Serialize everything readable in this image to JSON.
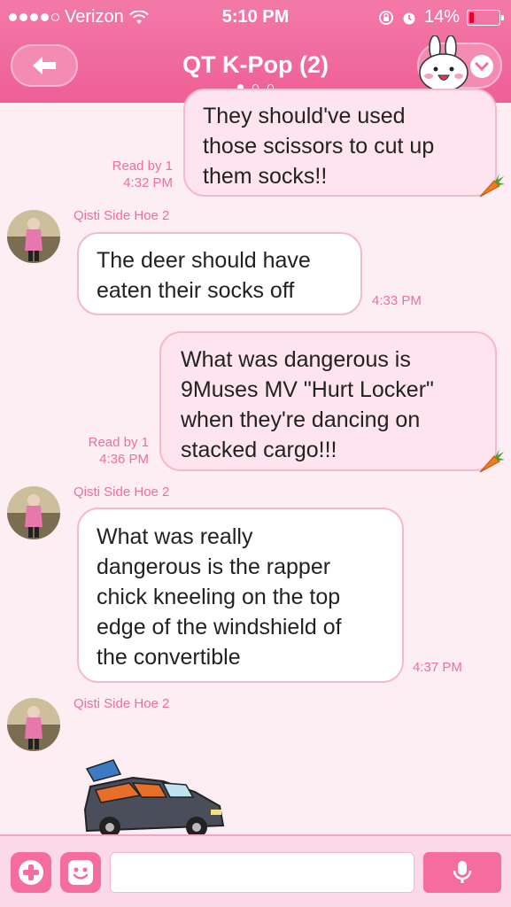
{
  "status_bar": {
    "carrier": "Verizon",
    "time": "5:10 PM",
    "battery": "14%",
    "signal_bars_filled": 4,
    "signal_bars_total": 5
  },
  "header": {
    "title": "QT K-Pop (2)",
    "page_count": 3,
    "active_page": 0
  },
  "messages": [
    {
      "type": "sent",
      "text": "They should've used\nthose scissors to cut up\nthem socks!!",
      "read": "Read by 1",
      "time": "4:32 PM"
    },
    {
      "type": "received",
      "sender": "Qisti Side Hoe 2",
      "text": "The deer should have\neaten their socks off",
      "time": "4:33 PM"
    },
    {
      "type": "sent",
      "text": "What was dangerous is\n9Muses MV \"Hurt Locker\"\nwhen they're dancing on\nstacked cargo!!!",
      "read": "Read by 1",
      "time": "4:36 PM"
    },
    {
      "type": "received",
      "sender": "Qisti Side Hoe 2",
      "text": "What was really\ndangerous is the rapper\nchick kneeling on the top\nedge of the windshield of\nthe convertible",
      "time": "4:37 PM"
    },
    {
      "type": "received-sticker",
      "sender": "Qisti Side Hoe 2",
      "sticker": "convertible-car-sticker"
    }
  ],
  "input": {
    "placeholder": "",
    "value": ""
  },
  "icons": {
    "back": "back-arrow-icon",
    "menu": "bunny-avatar-icon",
    "add": "plus-icon",
    "emoji": "emoji-icon",
    "mic": "microphone-icon"
  },
  "colors": {
    "header": "#ef6a9c",
    "accent": "#ee6f9b",
    "sent_bubble": "#fde4ee",
    "received_bubble": "#ffffff",
    "background": "#fdeef4"
  }
}
